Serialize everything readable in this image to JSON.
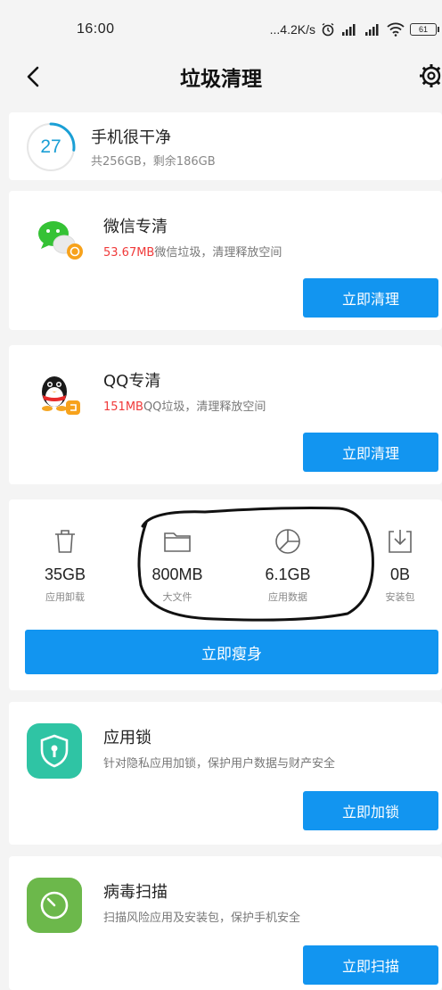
{
  "status_bar": {
    "time": "16:00",
    "network_speed": "...4.2K/s",
    "battery": "61",
    "icons": [
      "alarm-icon",
      "signal-icon",
      "signal-icon",
      "wifi-icon",
      "battery-icon"
    ]
  },
  "nav": {
    "title": "垃圾清理",
    "back_icon": "back-icon",
    "settings_icon": "settings-icon"
  },
  "summary": {
    "score": "27",
    "title": "手机很干净",
    "storage": "共256GB，剩余186GB",
    "ring_color": "#1a9fd5",
    "ring_progress": 0.27
  },
  "wechat": {
    "title": "微信专清",
    "highlight": "53.67MB",
    "desc": "微信垃圾，清理释放空间",
    "button": "立即清理"
  },
  "qq": {
    "title": "QQ专清",
    "highlight": "151MB",
    "desc": "QQ垃圾，清理释放空间",
    "button": "立即清理"
  },
  "storage_stats": {
    "items": [
      {
        "icon": "trash-icon",
        "value": "35GB",
        "label": "应用卸载"
      },
      {
        "icon": "folder-icon",
        "value": "800MB",
        "label": "大文件"
      },
      {
        "icon": "pie-chart-icon",
        "value": "6.1GB",
        "label": "应用数据"
      },
      {
        "icon": "download-icon",
        "value": "0B",
        "label": "安装包"
      }
    ],
    "button": "立即瘦身"
  },
  "app_lock": {
    "title": "应用锁",
    "desc": "针对隐私应用加锁，保护用户数据与财产安全",
    "button": "立即加锁",
    "icon_color": "#2fc4a4"
  },
  "virus_scan": {
    "title": "病毒扫描",
    "desc": "扫描风险应用及安装包，保护手机安全",
    "button": "立即扫描",
    "icon_color": "#6cb84b"
  },
  "colors": {
    "accent": "#1295f0",
    "highlight": "#f03a3a"
  }
}
